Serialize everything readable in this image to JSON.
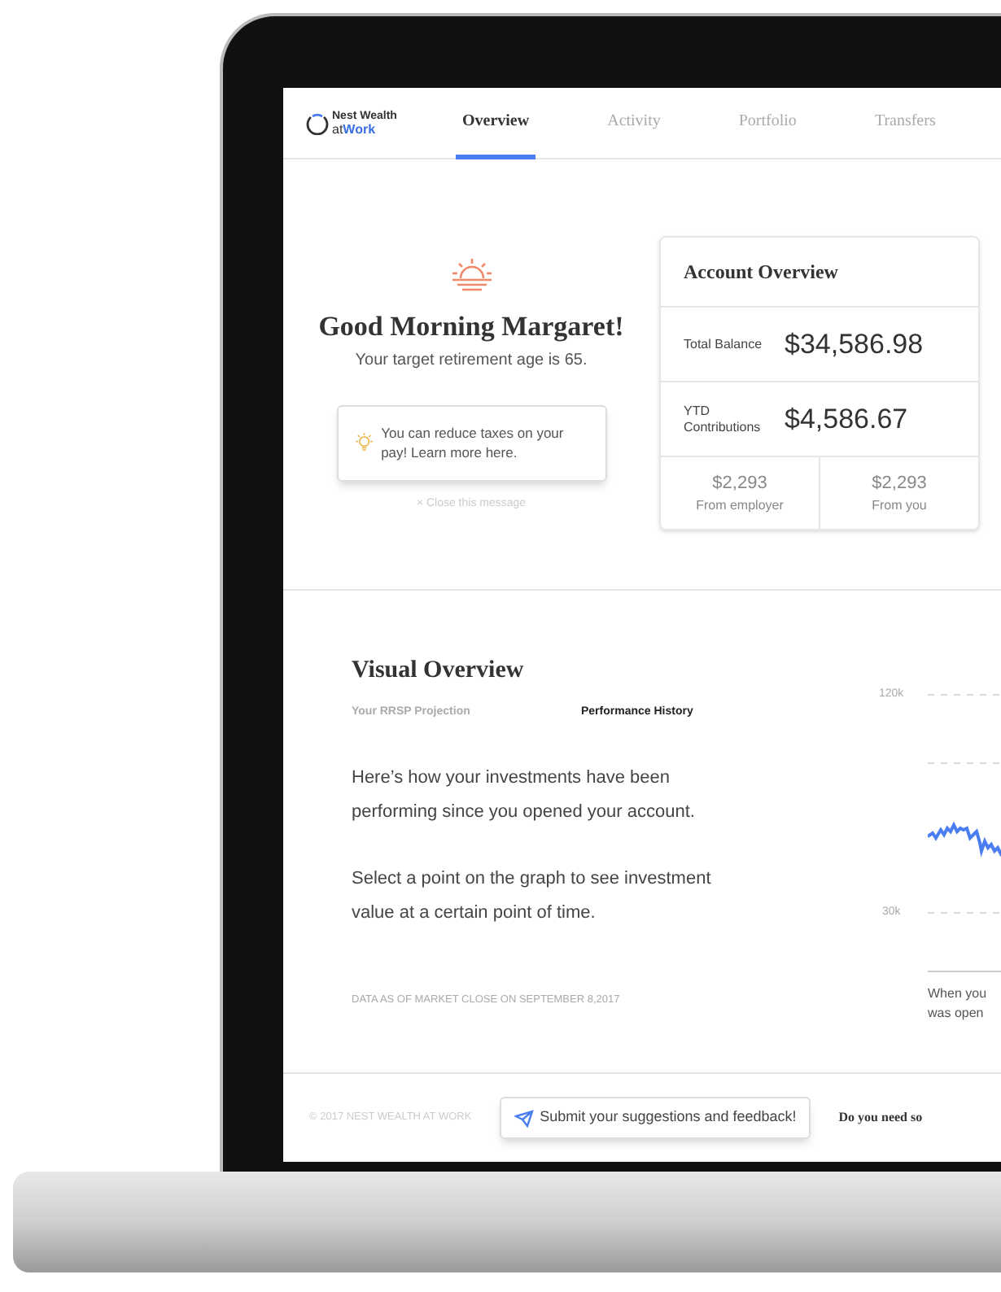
{
  "logo": {
    "line_1": "Nest Wealth",
    "line_2_prefix": "at",
    "line_2_accent": "Work"
  },
  "tabs": [
    {
      "label": "Overview",
      "selected": true
    },
    {
      "label": "Activity",
      "selected": false
    },
    {
      "label": "Portfolio",
      "selected": false
    },
    {
      "label": "Transfers",
      "selected": false
    }
  ],
  "greeting": {
    "title": "Good Morning Margaret!",
    "subtitle": "Your target retirement age is 65.",
    "tip": "You can reduce taxes on your pay! Learn more here.",
    "close_icon": "×",
    "close": "Close this message"
  },
  "account_overview": {
    "title": "Account Overview",
    "rows": [
      {
        "label": "Total Balance",
        "value": "$34,586.98"
      },
      {
        "label": "YTD Contributions",
        "value": "$4,586.67"
      }
    ],
    "split": [
      {
        "value": "$2,293",
        "label": "From employer"
      },
      {
        "value": "$2,293",
        "label": "From you"
      }
    ]
  },
  "visual_overview": {
    "title": "Visual Overview",
    "tabs": [
      {
        "label": "Your RRSP Projection",
        "selected": false
      },
      {
        "label": "Performance History",
        "selected": true
      }
    ],
    "paragraphs": [
      "Here’s how your investments have been performing since you opened your account.",
      "Select a point on the graph to see investment value at a certain point of time."
    ],
    "footnote": "DATA AS OF MARKET CLOSE ON SEPTEMBER 8,2017",
    "chart": {
      "y_labels": [
        "120k",
        "30k"
      ],
      "caption": [
        "When you",
        "was open"
      ]
    }
  },
  "footer": {
    "copyright": "© 2017 NEST WEALTH AT WORK",
    "feedback_button": "Submit your suggestions and feedback!",
    "help": "Do you need so"
  }
}
